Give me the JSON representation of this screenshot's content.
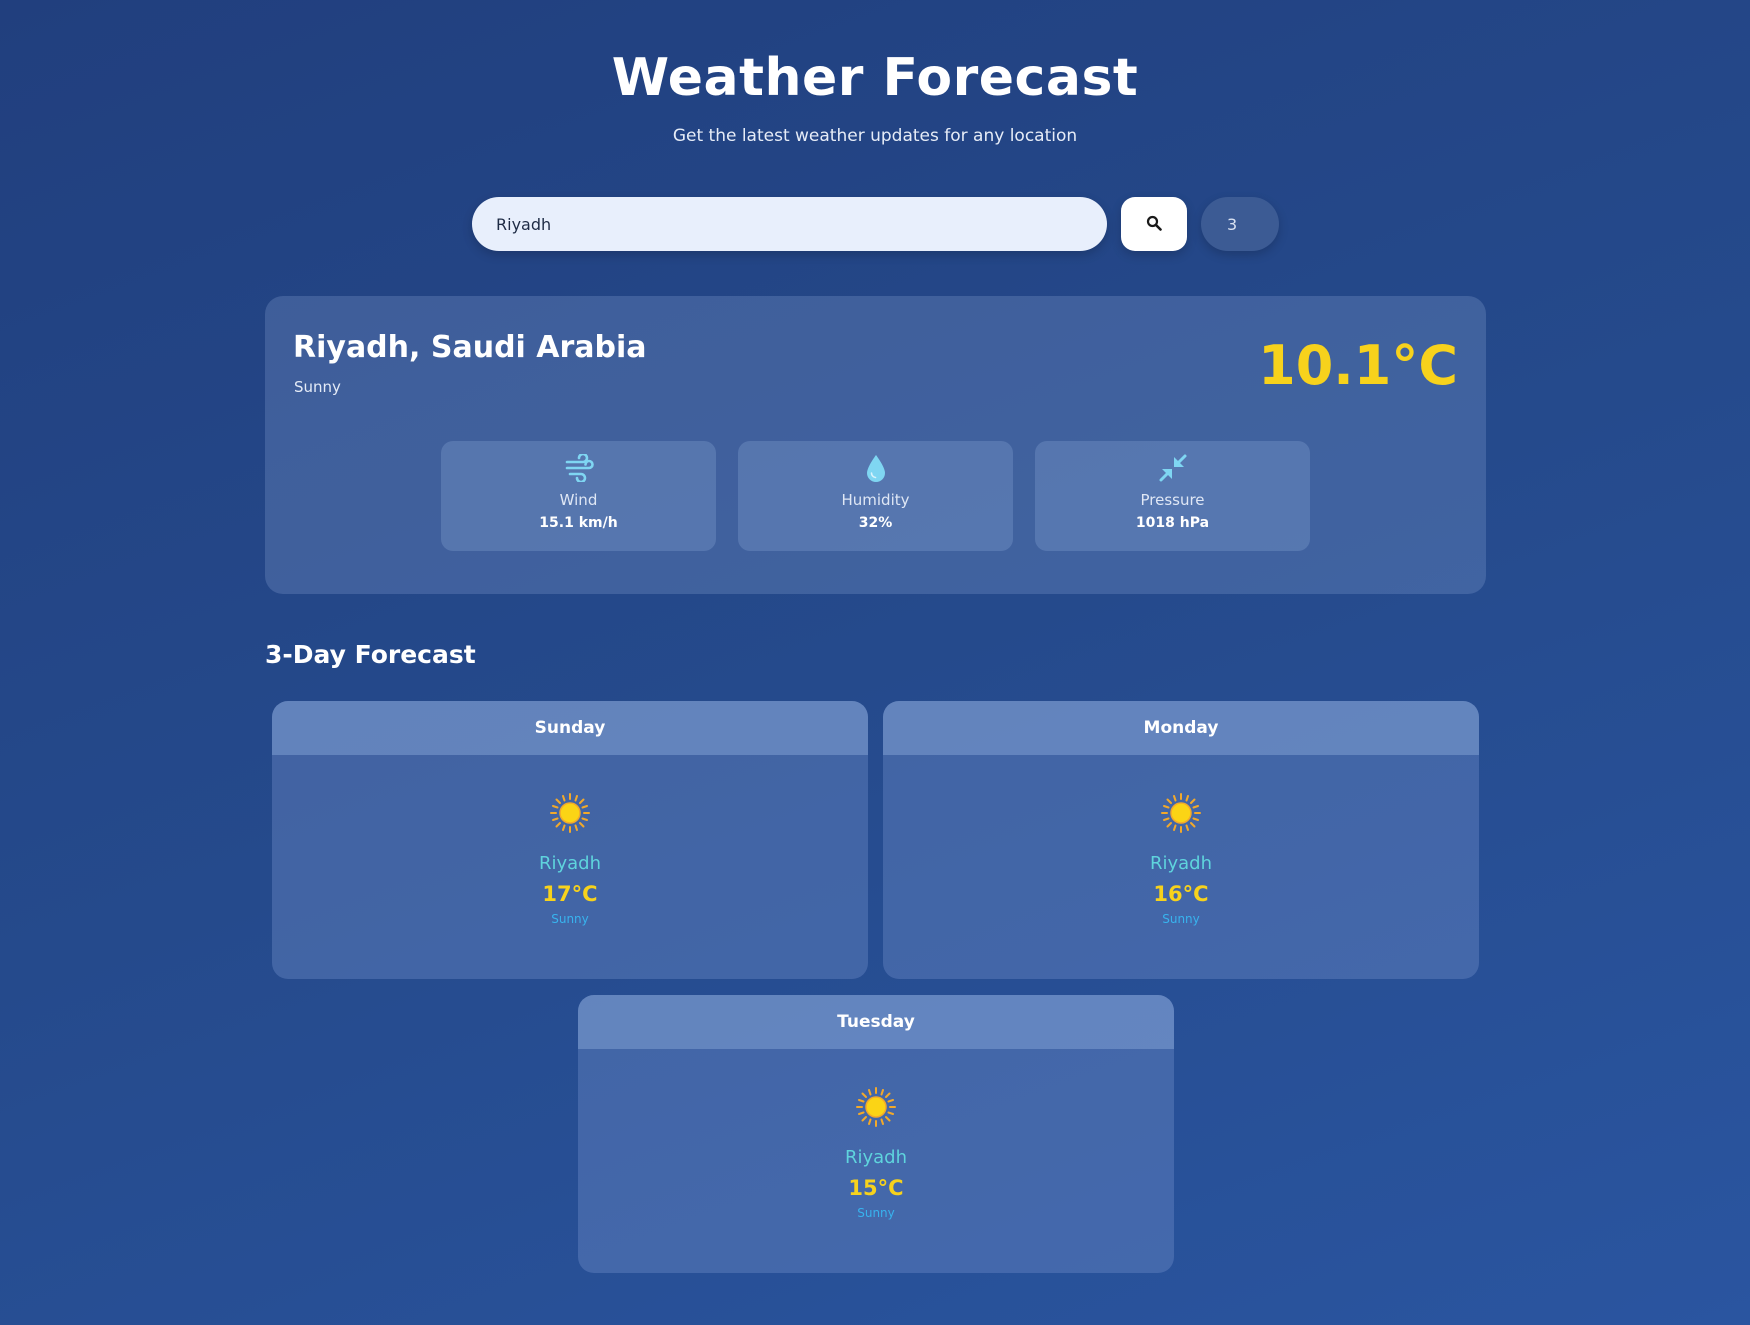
{
  "header": {
    "title": "Weather Forecast",
    "subtitle": "Get the latest weather updates for any location"
  },
  "search": {
    "value": "Riyadh",
    "button_icon": "search-icon",
    "days_value": "3"
  },
  "current": {
    "city": "Riyadh, Saudi Arabia",
    "condition": "Sunny",
    "temperature": "10.1°C",
    "stats": [
      {
        "icon": "wind-icon",
        "label": "Wind",
        "value": "15.1 km/h"
      },
      {
        "icon": "droplet-icon",
        "label": "Humidity",
        "value": "32%"
      },
      {
        "icon": "compress-icon",
        "label": "Pressure",
        "value": "1018 hPa"
      }
    ]
  },
  "forecast": {
    "title": "3-Day Forecast",
    "days": [
      {
        "day": "Sunday",
        "icon": "sun-icon",
        "city": "Riyadh",
        "temp": "17°C",
        "condition": "Sunny"
      },
      {
        "day": "Monday",
        "icon": "sun-icon",
        "city": "Riyadh",
        "temp": "16°C",
        "condition": "Sunny"
      },
      {
        "day": "Tuesday",
        "icon": "sun-icon",
        "city": "Riyadh",
        "temp": "15°C",
        "condition": "Sunny"
      }
    ]
  },
  "colors": {
    "background": "#254a8c",
    "accent_temp": "#f7d21c",
    "city_teal": "#5fd4dd",
    "condition_blue": "#38b3ee",
    "icon_cyan": "#7fd6f2"
  }
}
